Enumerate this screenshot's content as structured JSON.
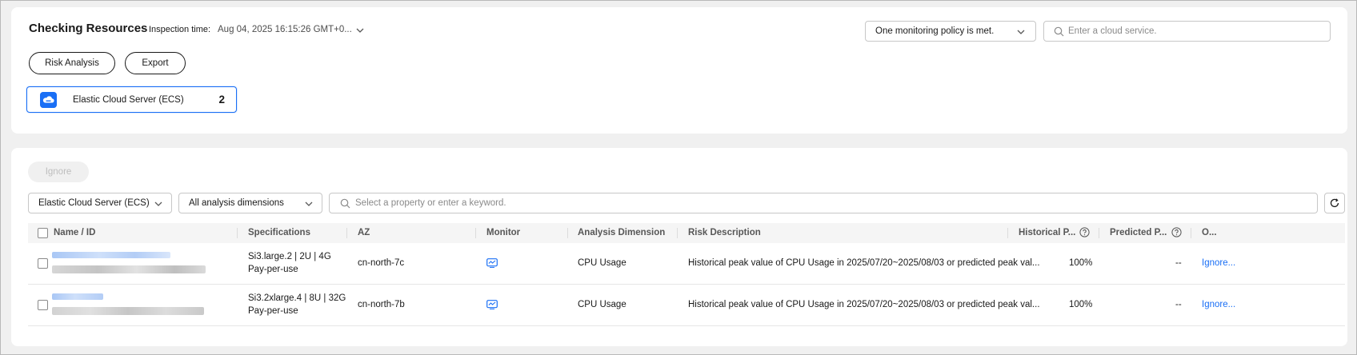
{
  "header": {
    "title": "Checking Resources",
    "inspection_label": "Inspection time:",
    "inspection_value": "Aug 04, 2025 16:15:26 GMT+0...",
    "policy_select": "One monitoring policy is met.",
    "cloud_search_placeholder": "Enter a cloud service."
  },
  "actions": {
    "risk_analysis": "Risk Analysis",
    "export": "Export"
  },
  "service_card": {
    "name": "Elastic Cloud Server (ECS)",
    "count": "2"
  },
  "list": {
    "ignore_button": "Ignore",
    "filter_service": "Elastic Cloud Server (ECS)",
    "filter_dimension": "All analysis dimensions",
    "keyword_placeholder": "Select a property or enter a keyword.",
    "columns": {
      "name": "Name / ID",
      "specs": "Specifications",
      "az": "AZ",
      "monitor": "Monitor",
      "dimension": "Analysis Dimension",
      "risk": "Risk Description",
      "historical": "Historical P...",
      "predicted": "Predicted P...",
      "operation": "O..."
    },
    "rows": [
      {
        "spec": "Si3.large.2 | 2U | 4G",
        "billing": "Pay-per-use",
        "az": "cn-north-7c",
        "dimension": "CPU Usage",
        "risk": "Historical peak value of CPU Usage in 2025/07/20~2025/08/03 or predicted peak val...",
        "historical": "100%",
        "predicted": "--",
        "operation": "Ignore..."
      },
      {
        "spec": "Si3.2xlarge.4 | 8U | 32G",
        "billing": "Pay-per-use",
        "az": "cn-north-7b",
        "dimension": "CPU Usage",
        "risk": "Historical peak value of CPU Usage in 2025/07/20~2025/08/03 or predicted peak val...",
        "historical": "100%",
        "predicted": "--",
        "operation": "Ignore..."
      }
    ]
  },
  "colors": {
    "accent": "#1a6ff5",
    "text": "#191919",
    "muted": "#8a8a8a",
    "background": "#f0f0f0"
  }
}
